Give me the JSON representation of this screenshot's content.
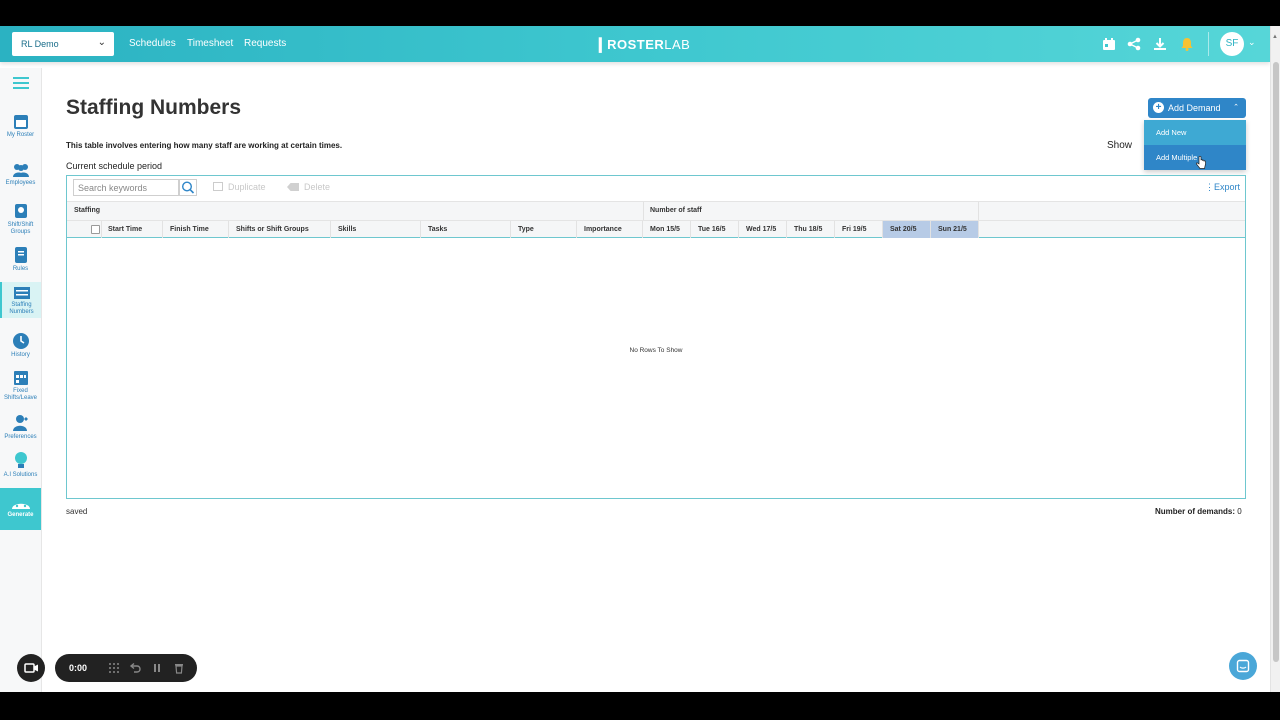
{
  "header": {
    "org_select": "RL Demo",
    "nav": [
      "Schedules",
      "Timesheet",
      "Requests"
    ],
    "logo_main": "ROSTER",
    "logo_sub": "LAB",
    "avatar_initials": "SF",
    "icons": [
      "calendar-icon",
      "share-icon",
      "download-icon",
      "bell-icon"
    ]
  },
  "sidebar": {
    "items": [
      {
        "label": "My Roster",
        "icon": "calendar-icon"
      },
      {
        "label": "Employees",
        "icon": "people-icon"
      },
      {
        "label": "Shift/Shift Groups",
        "icon": "shift-icon"
      },
      {
        "label": "Rules",
        "icon": "book-icon"
      },
      {
        "label": "Staffing Numbers",
        "icon": "table-icon",
        "active": true
      },
      {
        "label": "History",
        "icon": "history-icon"
      },
      {
        "label": "Fixed Shifts/Leave",
        "icon": "calendar-grid-icon"
      },
      {
        "label": "Preferences",
        "icon": "person-heart-icon"
      },
      {
        "label": "A.I Solutions",
        "icon": "lightbulb-icon"
      },
      {
        "label": "Generate",
        "icon": "robot-icon"
      }
    ]
  },
  "main": {
    "title": "Staffing Numbers",
    "description": "This table involves entering how many staff are working at certain times.",
    "period": "Current schedule period",
    "show_label": "Show",
    "add_demand": {
      "label": "Add Demand",
      "menu": [
        "Add New",
        "Add Multiple"
      ]
    },
    "toolbar": {
      "search_placeholder": "Search keywords",
      "duplicate": "Duplicate",
      "delete": "Delete",
      "export": "Export"
    },
    "table": {
      "group_staffing": "Staffing",
      "group_number": "Number of staff",
      "columns": [
        "Start Time",
        "Finish Time",
        "Shifts or Shift Groups",
        "Skills",
        "Tasks",
        "Type",
        "Importance"
      ],
      "days": [
        "Mon 15/5",
        "Tue 16/5",
        "Wed 17/5",
        "Thu 18/5",
        "Fri 19/5",
        "Sat 20/5",
        "Sun 21/5"
      ],
      "empty_text": "No Rows To Show"
    },
    "status": "saved",
    "demand_count_label": "Number of demands:",
    "demand_count": "0"
  },
  "recorder": {
    "time": "0:00"
  }
}
